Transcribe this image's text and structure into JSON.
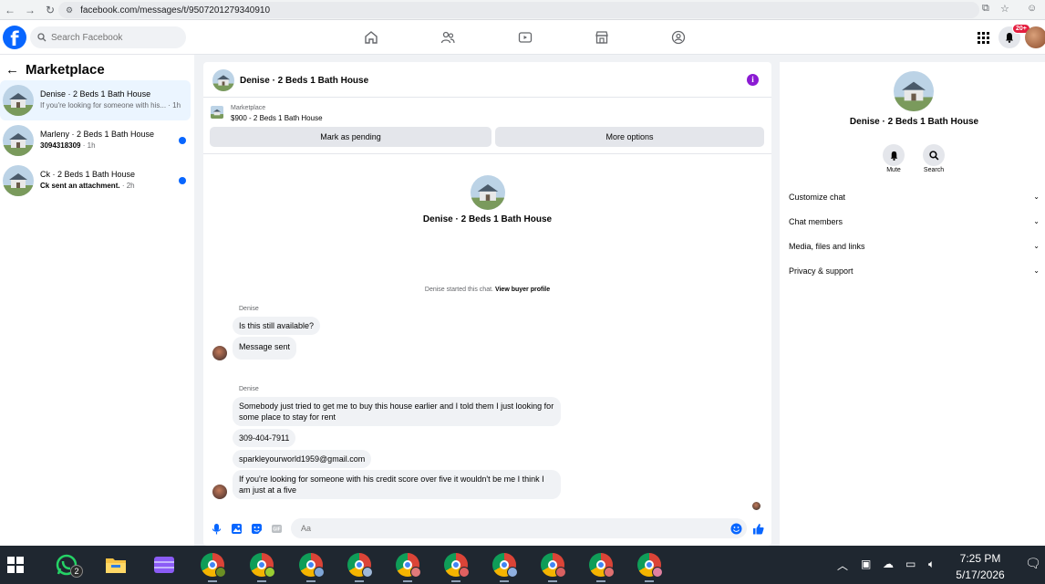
{
  "browser": {
    "url": "facebook.com/messages/t/9507201279340910"
  },
  "header": {
    "search_placeholder": "Search Facebook",
    "notification_badge": "20+",
    "brand_color": "#0866ff"
  },
  "left_panel": {
    "title": "Marketplace",
    "conversations": [
      {
        "name": "Denise · 2 Beds 1 Bath House",
        "snippet": "If you're looking for someone with his...",
        "time": "· 1h",
        "unread": false,
        "active": true
      },
      {
        "name": "Marleny · 2 Beds 1 Bath House",
        "snippet": "3094318309",
        "time": "· 1h",
        "unread": true,
        "active": false
      },
      {
        "name": "Ck · 2 Beds 1 Bath House",
        "snippet": "Ck sent an attachment.",
        "time": "· 2h",
        "unread": true,
        "active": false
      }
    ]
  },
  "chat": {
    "title": "Denise · 2 Beds 1 Bath House",
    "listing_category": "Marketplace",
    "listing_price": "$900 - 2 Beds 1 Bath House",
    "mark_pending_label": "Mark as pending",
    "more_options_label": "More options",
    "hero_name": "Denise · 2 Beds 1 Bath House",
    "started_text": "Denise started this chat.",
    "view_profile_label": "View buyer profile",
    "group1_sender": "Denise",
    "group2_sender": "Denise",
    "messages": [
      {
        "text": "Is this still available?"
      },
      {
        "text": "Message sent"
      },
      {
        "text": "Somebody just tried to get me to buy this house earlier and I told them I just looking for some place to stay for rent"
      },
      {
        "text": "309-404-7911"
      },
      {
        "text": "sparkleyourworld1959@gmail.com"
      },
      {
        "text": "If you're looking for someone with his credit score over five it wouldn't be me I think I am just at a five"
      }
    ],
    "composer_placeholder": "Aa"
  },
  "right_panel": {
    "name": "Denise · 2 Beds 1 Bath House",
    "mute_label": "Mute",
    "search_label": "Search",
    "sections": [
      {
        "label": "Customize chat"
      },
      {
        "label": "Chat members"
      },
      {
        "label": "Media, files and links"
      },
      {
        "label": "Privacy & support"
      }
    ]
  },
  "taskbar": {
    "whatsapp_badge": "2",
    "time": "7:25 PM",
    "date": "5/17/2026"
  }
}
